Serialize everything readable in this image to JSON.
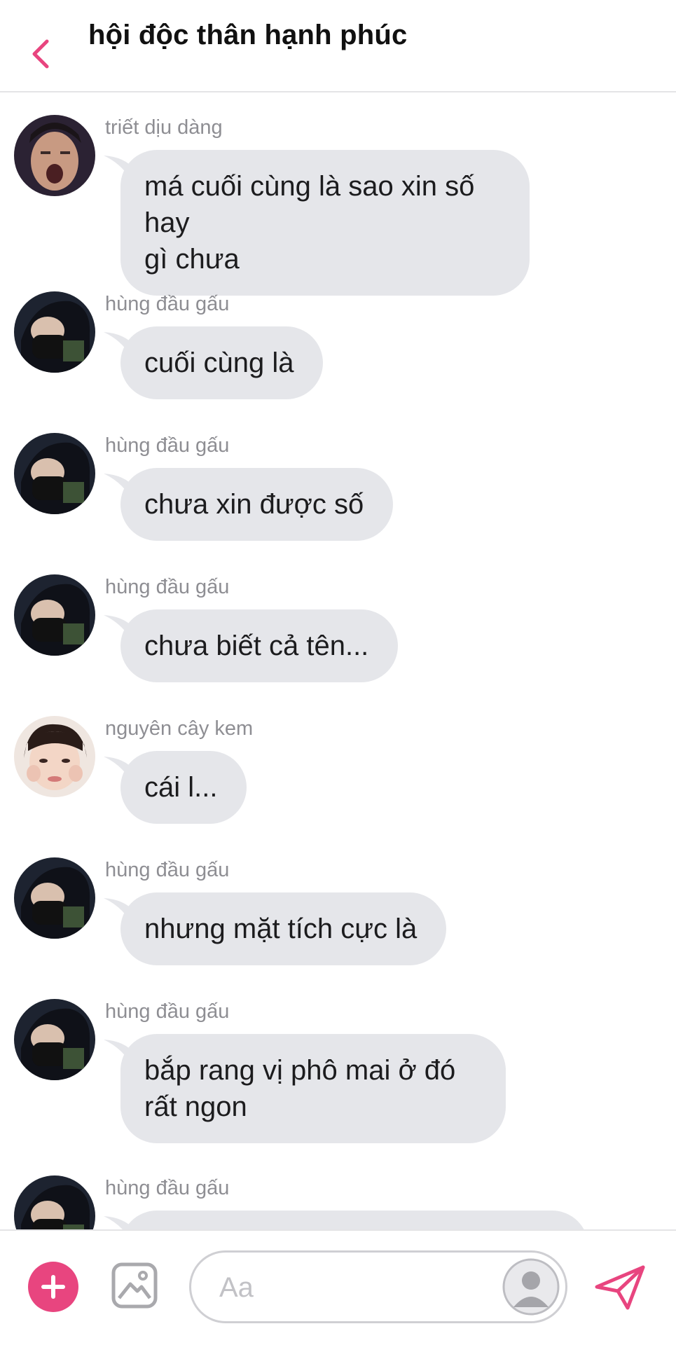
{
  "header": {
    "title": "hội độc thân hạnh phúc",
    "accent_color": "#e8457f"
  },
  "messages": [
    {
      "sender": "triết dịu dàng",
      "lines": [
        "má cuối cùng là sao xin số hay",
        "gì chưa"
      ]
    },
    {
      "sender": "hùng đầu gấu",
      "lines": [
        "cuối cùng là"
      ]
    },
    {
      "sender": "hùng đầu gấu",
      "lines": [
        "chưa xin được số"
      ]
    },
    {
      "sender": "hùng đầu gấu",
      "lines": [
        "chưa biết cả tên..."
      ]
    },
    {
      "sender": "nguyên cây kem",
      "lines": [
        "cái l..."
      ]
    },
    {
      "sender": "hùng đầu gấu",
      "lines": [
        "nhưng mặt tích cực là"
      ]
    },
    {
      "sender": "hùng đầu gấu",
      "lines": [
        "bắp rang vị phô mai ở đó",
        "rất ngon"
      ]
    },
    {
      "sender": "hùng đầu gấu",
      "lines": []
    }
  ],
  "composer": {
    "placeholder": "Aa",
    "icons": [
      "plus-icon",
      "image-icon",
      "profile-placeholder-icon",
      "send-icon"
    ]
  },
  "colors": {
    "bubble": "#e5e6ea",
    "sender_text": "#8e8e93",
    "accent": "#e8457f"
  }
}
